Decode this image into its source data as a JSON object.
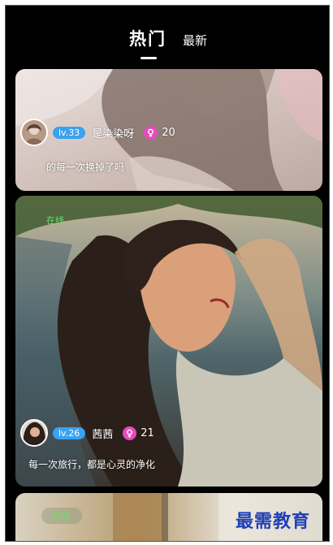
{
  "tabs": {
    "hot": "热门",
    "latest": "最新"
  },
  "posts": [
    {
      "level": "lv.33",
      "username": "是染染呀",
      "gender_icon": "female-icon",
      "likes": "20",
      "caption": "的每一次换掉了吗"
    },
    {
      "status": "在线",
      "level": "lv.26",
      "username": "茜茜",
      "gender_icon": "female-icon",
      "likes": "21",
      "caption": "每一次旅行，都是心灵的净化"
    },
    {
      "status": "在线"
    }
  ],
  "watermark": "最需教育",
  "colors": {
    "background": "#000000",
    "level_badge": "#3aa2ef",
    "female_badge": "#e64bbd",
    "online_text": "#6ce06c",
    "watermark": "#1e3fb5"
  }
}
